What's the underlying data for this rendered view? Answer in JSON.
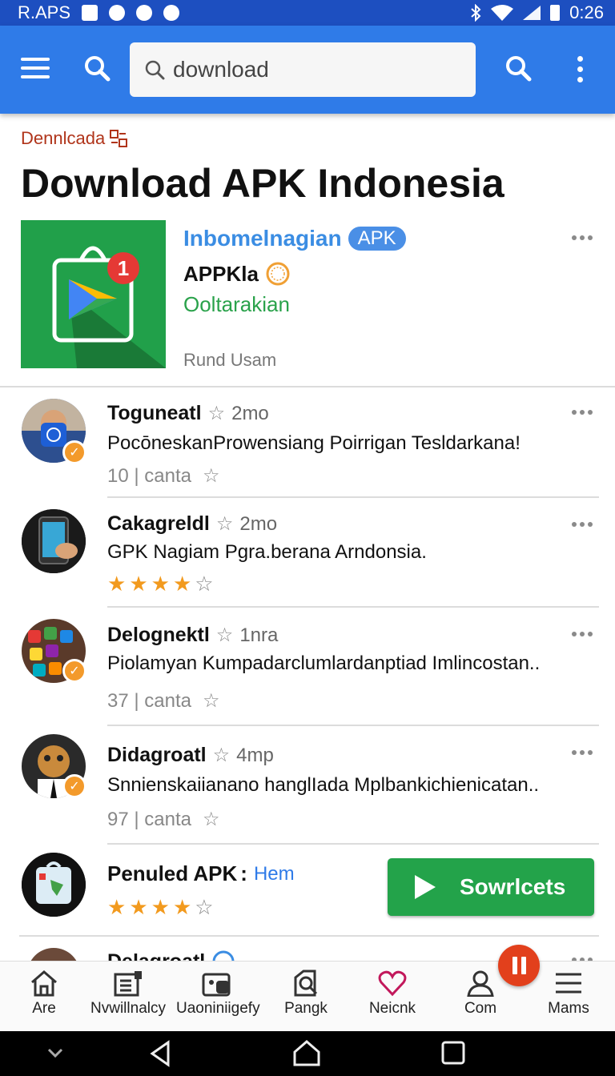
{
  "status_bar": {
    "left_text": "R.APS",
    "time": "0:26"
  },
  "search": {
    "value": "download",
    "placeholder": "download"
  },
  "breadcrumb": {
    "label": "Dennlcada"
  },
  "page": {
    "title": "Download APK Indonesia"
  },
  "featured": {
    "name": "Inbomelnagian",
    "badge": "APK",
    "developer": "APPKla",
    "category": "Ooltarakian",
    "run_label": "Rund Usam",
    "badge_count": "1"
  },
  "items": [
    {
      "title": "Toguneatl",
      "time": "2mo",
      "desc": "PocōneskanProwensiang Poirrigan  Tesldarkana!",
      "count": "10 | canta"
    },
    {
      "title": "Cakagreldl",
      "time": "2mo",
      "desc": "GPK Nagiam Pgra.berana Arndonsia."
    },
    {
      "title": "Delognektl",
      "time": "1nra",
      "desc": "Piolamyan Kumpadarclumlardanptiad Imlincostan..",
      "count": "37 | canta"
    },
    {
      "title": "Didagroatl",
      "time": "4mp",
      "desc": "Snnienskaiianano hanglIada Mplbankichienicatan..",
      "count": "97 | canta"
    },
    {
      "title": "Penuled APK",
      "sep": ":",
      "tag": "Hem"
    },
    {
      "title": "Delagroatl"
    }
  ],
  "ratings": {
    "item2": 4,
    "item5": 4,
    "max": 5
  },
  "install_button": {
    "label": "Sowrlcets"
  },
  "bottom_nav": [
    {
      "label": "Are",
      "icon": "home-icon"
    },
    {
      "label": "Nvwillnalcy",
      "icon": "library-icon"
    },
    {
      "label": "Uaoniniigefy",
      "icon": "category-icon"
    },
    {
      "label": "Pangk",
      "icon": "search-page-icon"
    },
    {
      "label": "Neicnk",
      "icon": "heart-icon"
    },
    {
      "label": "Com",
      "icon": "person-icon"
    },
    {
      "label": "Mams",
      "icon": "menu-icon"
    }
  ],
  "colors": {
    "app_bar": "#2f7be8",
    "status_bar": "#1d4fc0",
    "accent_green": "#23a34a",
    "star": "#f29a1e",
    "fab": "#e2401c"
  }
}
